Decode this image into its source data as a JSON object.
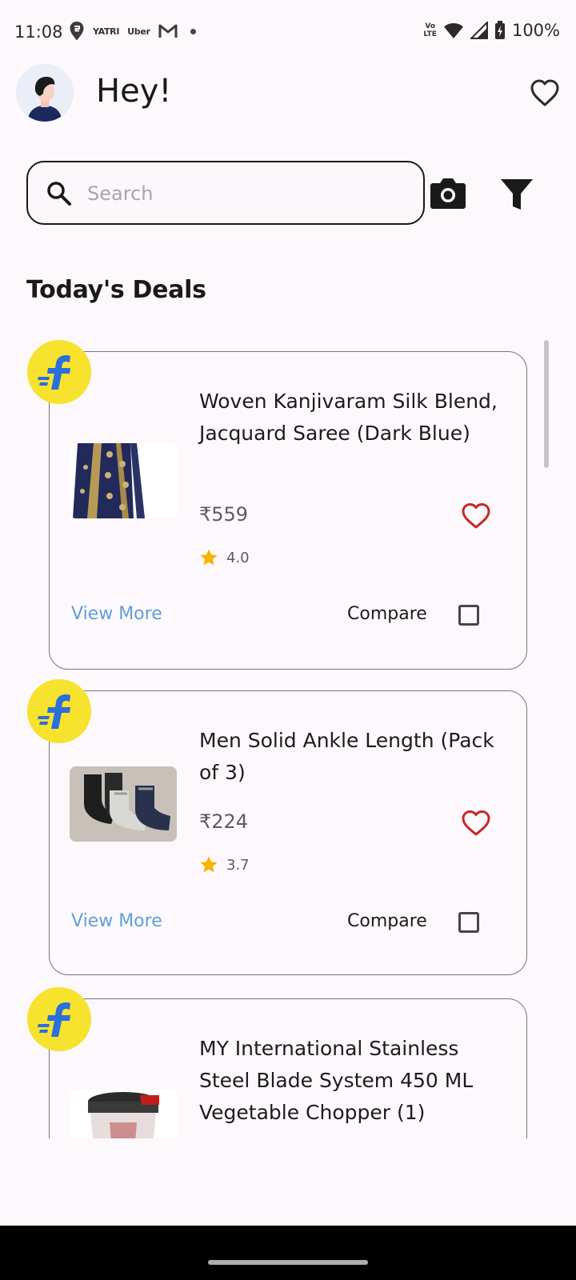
{
  "status_bar": {
    "time": "11:08",
    "apps": [
      "swiggy-icon",
      "YATRI",
      "Uber",
      "gmail-icon"
    ],
    "network_label_top": "Vo",
    "network_label_bottom": "LTE",
    "battery_percent": "100%"
  },
  "header": {
    "greeting": "Hey!",
    "favorites_icon": "heart-outline-icon"
  },
  "search": {
    "placeholder": "Search",
    "value": "",
    "camera_icon": "camera-icon",
    "filter_icon": "filter-icon"
  },
  "section": {
    "title": "Today's Deals"
  },
  "deals": [
    {
      "title": "Woven Kanjivaram Silk Blend, Jacquard Saree (Dark Blue)",
      "price": "₹559",
      "rating": "4.0",
      "view_more": "View More",
      "compare": "Compare",
      "compare_checked": false,
      "store_badge": "flipkart-logo"
    },
    {
      "title": "Men Solid Ankle Length (Pack of 3)",
      "price": "₹224",
      "rating": "3.7",
      "view_more": "View More",
      "compare": "Compare",
      "compare_checked": false,
      "store_badge": "flipkart-logo"
    },
    {
      "title": "MY International Stainless Steel Blade System 450 ML Vegetable Chopper  (1)",
      "store_badge": "flipkart-logo"
    }
  ],
  "colors": {
    "background": "#fcf8fb",
    "accent_link": "#5f9fdc",
    "heart": "#c62828",
    "star": "#f5b400",
    "badge": "#f7e22d",
    "badge_logo": "#2a6fdc"
  }
}
